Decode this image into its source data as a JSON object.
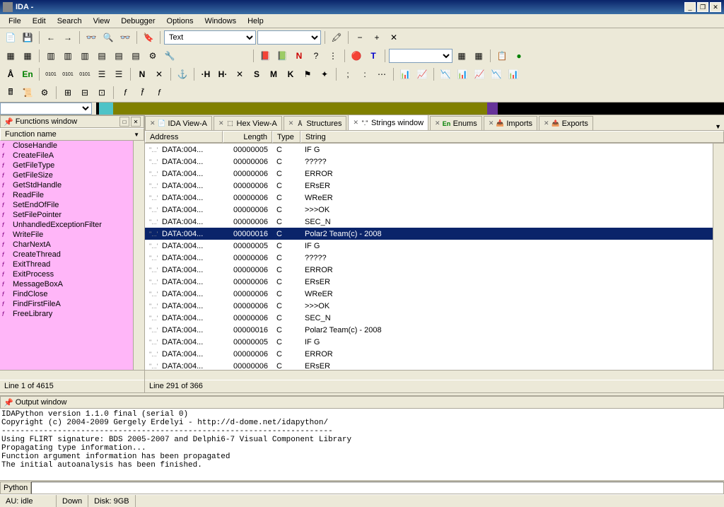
{
  "title": "IDA -",
  "menus": [
    "File",
    "Edit",
    "Search",
    "View",
    "Debugger",
    "Options",
    "Windows",
    "Help"
  ],
  "combo_text": "Text",
  "functions_panel": {
    "title": "Functions window",
    "col": "Function name",
    "items": [
      "CloseHandle",
      "CreateFileA",
      "GetFileType",
      "GetFileSize",
      "GetStdHandle",
      "ReadFile",
      "SetEndOfFile",
      "SetFilePointer",
      "UnhandledExceptionFilter",
      "WriteFile",
      "CharNextA",
      "CreateThread",
      "ExitThread",
      "ExitProcess",
      "MessageBoxA",
      "FindClose",
      "FindFirstFileA",
      "FreeLibrary"
    ],
    "status": "Line 1 of 4615"
  },
  "tabs": [
    {
      "label": "IDA View-A",
      "icon": "📄"
    },
    {
      "label": "Hex View-A",
      "icon": "⬚"
    },
    {
      "label": "Structures",
      "icon": "Å"
    },
    {
      "label": "Strings window",
      "icon": "\".\"",
      "active": true
    },
    {
      "label": "Enums",
      "icon": "En",
      "green": true
    },
    {
      "label": "Imports",
      "icon": "📥"
    },
    {
      "label": "Exports",
      "icon": "📤"
    }
  ],
  "strings": {
    "cols": [
      "Address",
      "Length",
      "Type",
      "String"
    ],
    "rows": [
      {
        "addr": "DATA:004...",
        "len": "00000005",
        "type": "C",
        "str": "IF G"
      },
      {
        "addr": "DATA:004...",
        "len": "00000006",
        "type": "C",
        "str": "?????"
      },
      {
        "addr": "DATA:004...",
        "len": "00000006",
        "type": "C",
        "str": "ERROR"
      },
      {
        "addr": "DATA:004...",
        "len": "00000006",
        "type": "C",
        "str": "ERsER"
      },
      {
        "addr": "DATA:004...",
        "len": "00000006",
        "type": "C",
        "str": "WReER"
      },
      {
        "addr": "DATA:004...",
        "len": "00000006",
        "type": "C",
        "str": ">>>OK"
      },
      {
        "addr": "DATA:004...",
        "len": "00000006",
        "type": "C",
        "str": "SEC_N"
      },
      {
        "addr": "DATA:004...",
        "len": "00000016",
        "type": "C",
        "str": "Polar2 Team(c) - 2008",
        "selected": true
      },
      {
        "addr": "DATA:004...",
        "len": "00000005",
        "type": "C",
        "str": "IF G"
      },
      {
        "addr": "DATA:004...",
        "len": "00000006",
        "type": "C",
        "str": "?????"
      },
      {
        "addr": "DATA:004...",
        "len": "00000006",
        "type": "C",
        "str": "ERROR"
      },
      {
        "addr": "DATA:004...",
        "len": "00000006",
        "type": "C",
        "str": "ERsER"
      },
      {
        "addr": "DATA:004...",
        "len": "00000006",
        "type": "C",
        "str": "WReER"
      },
      {
        "addr": "DATA:004...",
        "len": "00000006",
        "type": "C",
        "str": ">>>OK"
      },
      {
        "addr": "DATA:004...",
        "len": "00000006",
        "type": "C",
        "str": "SEC_N"
      },
      {
        "addr": "DATA:004...",
        "len": "00000016",
        "type": "C",
        "str": "Polar2 Team(c) - 2008"
      },
      {
        "addr": "DATA:004...",
        "len": "00000005",
        "type": "C",
        "str": "IF G"
      },
      {
        "addr": "DATA:004...",
        "len": "00000006",
        "type": "C",
        "str": "ERROR"
      },
      {
        "addr": "DATA:004...",
        "len": "00000006",
        "type": "C",
        "str": "ERsER"
      }
    ],
    "status": "Line 291 of 366"
  },
  "output": {
    "title": "Output window",
    "text": "IDAPython version 1.1.0 final (serial 0)\nCopyright (c) 2004-2009 Gergely Erdelyi - http://d-dome.net/idapython/\n-----------------------------------------------------------------------\nUsing FLIRT signature: BDS 2005-2007 and Delphi6-7 Visual Component Library\nPropagating type information...\nFunction argument information has been propagated\nThe initial autoanalysis has been finished."
  },
  "python_label": "Python",
  "status": {
    "au": "AU: idle",
    "down": "Down",
    "disk": "Disk: 9GB"
  }
}
